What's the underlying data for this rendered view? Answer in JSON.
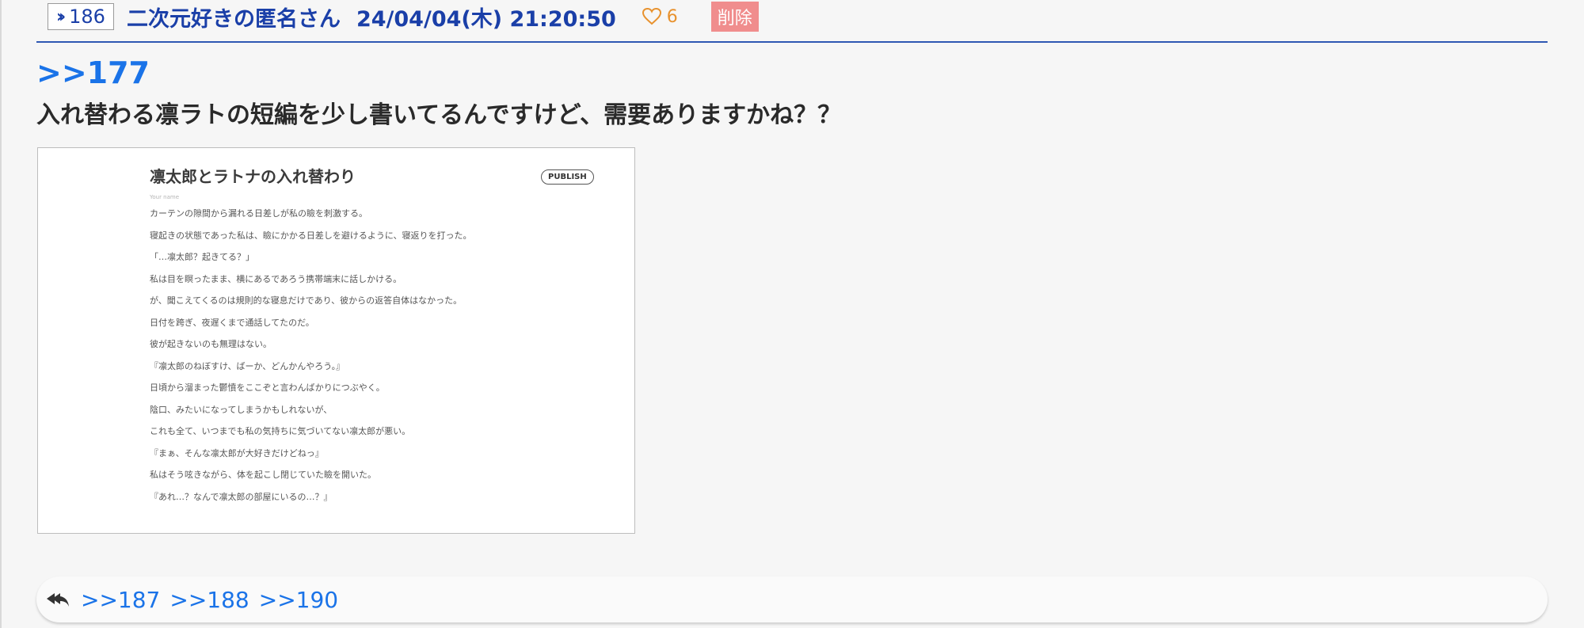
{
  "post": {
    "number_label": "186",
    "author": "二次元好きの匿名さん",
    "datetime": "24/04/04(木) 21:20:50",
    "likes": "6",
    "delete_label": "削除",
    "anchor": ">>177",
    "message": "入れ替わる凛ラトの短編を少し書いてるんですけど、需要ありますかね？？"
  },
  "attachment": {
    "title": "凛太郎とラトナの入れ替わり",
    "publish_label": "PUBLISH",
    "author_placeholder": "Your name",
    "lines": [
      "カーテンの隙間から漏れる日差しが私の瞼を刺激する。",
      "寝起きの状態であった私は、瞼にかかる日差しを避けるように、寝返りを打った。",
      "「…凛太郎？起きてる？」",
      "私は目を瞑ったまま、横にあるであろう携帯端末に話しかける。",
      "が、聞こえてくるのは規則的な寝息だけであり、彼からの返答自体はなかった。",
      "日付を跨ぎ、夜遅くまで通話してたのだ。",
      "彼が起きないのも無理はない。",
      "『凛太郎のねぼすけ、ばーか、どんかんやろう。』",
      "日頃から溜まった鬱憤をここぞと言わんばかりにつぶやく。",
      "陰口、みたいになってしまうかもしれないが、",
      "これも全て、いつまでも私の気持ちに気づいてない凛太郎が悪い。",
      "『まぁ、そんな凛太郎が大好きだけどねっ』",
      "私はそう呟きながら、体を起こし閉じていた瞼を開いた。",
      "『あれ…？なんで凛太郎の部屋にいるの…？』"
    ]
  },
  "replies": [
    ">>187",
    ">>188",
    ">>190"
  ],
  "icons": {
    "number": "double-chevron-icon",
    "like": "heart-icon",
    "reply": "reply-all-icon"
  },
  "colors": {
    "link": "#1a73e8",
    "header_text": "#1a3fa8",
    "like": "#e8922e",
    "delete_bg": "#f08d8d",
    "rule": "#2f58b3"
  }
}
